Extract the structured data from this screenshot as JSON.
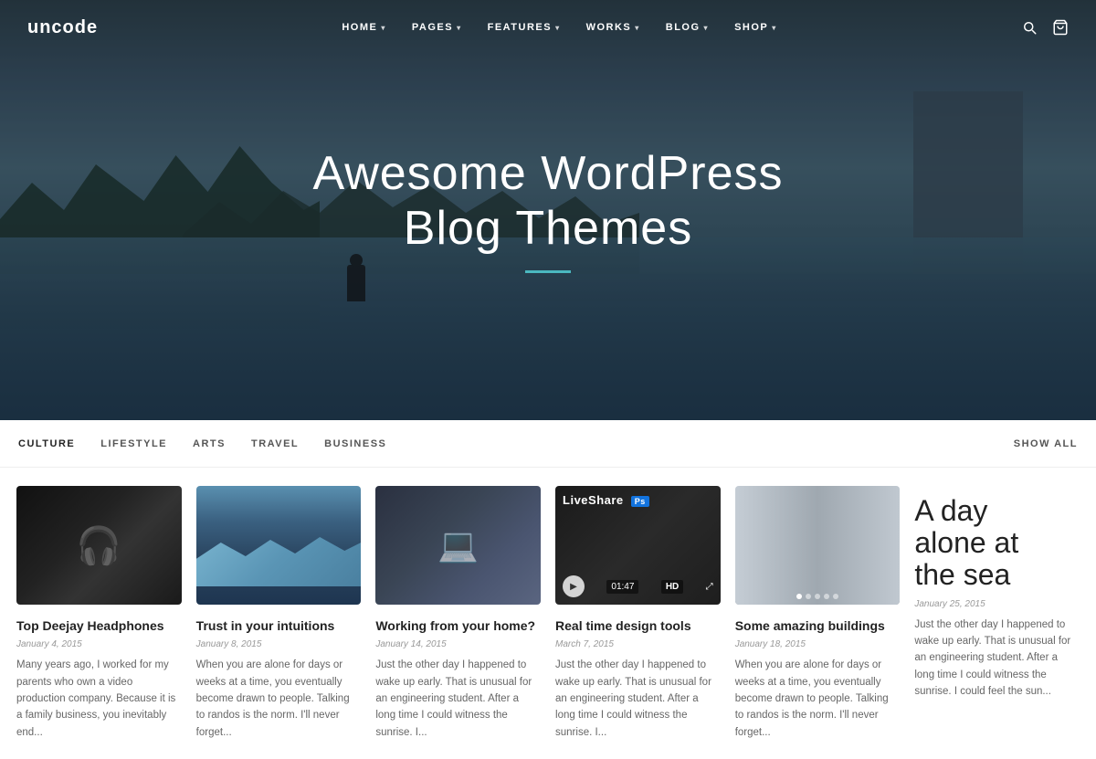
{
  "logo": "uncode",
  "nav": {
    "items": [
      {
        "label": "HOME",
        "hasDropdown": true
      },
      {
        "label": "PAGES",
        "hasDropdown": true
      },
      {
        "label": "FEATURES",
        "hasDropdown": true
      },
      {
        "label": "WORKS",
        "hasDropdown": true
      },
      {
        "label": "BLOG",
        "hasDropdown": true
      },
      {
        "label": "SHOP",
        "hasDropdown": true
      }
    ]
  },
  "hero": {
    "title_line1": "Awesome WordPress",
    "title_line2": "Blog Themes"
  },
  "filter": {
    "tabs": [
      "CULTURE",
      "LIFESTYLE",
      "ARTS",
      "TRAVEL",
      "BUSINESS"
    ],
    "show_all": "SHOW ALL"
  },
  "cards": [
    {
      "id": "card1",
      "type": "image",
      "image_type": "headphones",
      "title": "Top Deejay Headphones",
      "date": "January 4, 2015",
      "excerpt": "Many years ago, I worked for my parents who own a video production company. Because it is a family business, you inevitably end..."
    },
    {
      "id": "card2",
      "type": "image",
      "image_type": "waves",
      "title": "Trust in your intuitions",
      "date": "January 8, 2015",
      "excerpt": "When you are alone for days or weeks at a time, you eventually become drawn to people. Talking to randos is the norm. I'll never forget..."
    },
    {
      "id": "card3",
      "type": "image",
      "image_type": "laptop",
      "title": "Working from your home?",
      "date": "January 14, 2015",
      "excerpt": "Just the other day I happened to wake up early. That is unusual for an engineering student. After a long time I could witness the sunrise. I..."
    },
    {
      "id": "card4",
      "type": "video",
      "image_type": "video",
      "video_title": "LiveShare",
      "video_app": "Ps",
      "video_time": "01:47",
      "title": "Real time design tools",
      "date": "March 7, 2015",
      "excerpt": "Just the other day I happened to wake up early. That is unusual for an engineering student. After a long time I could witness the sunrise. I..."
    },
    {
      "id": "card5",
      "type": "image",
      "image_type": "buildings",
      "title": "Some amazing buildings",
      "date": "January 18, 2015",
      "excerpt": "When you are alone for days or weeks at a time, you eventually become drawn to people. Talking to randos is the norm. I'll never forget..."
    },
    {
      "id": "card6",
      "type": "text",
      "big_title_line1": "A day",
      "big_title_line2": "alone at",
      "big_title_line3": "the sea",
      "date": "January 25, 2015",
      "excerpt": "Just the other day I happened to wake up early. That is unusual for an engineering student. After a long time I could witness the sunrise. I could feel the sun..."
    }
  ]
}
